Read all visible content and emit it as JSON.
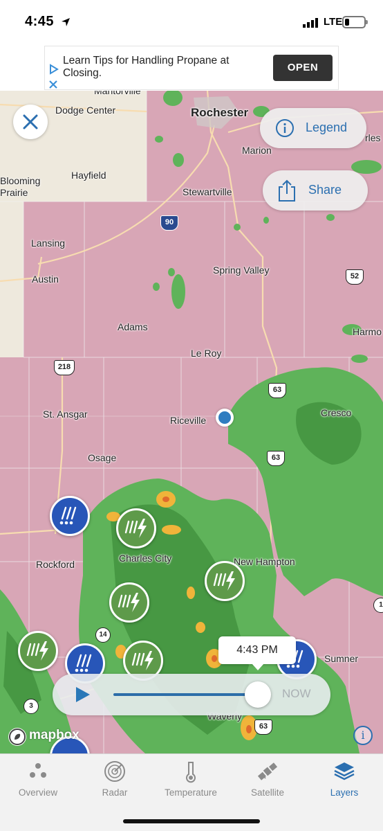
{
  "status": {
    "time": "4:45",
    "network": "LTE"
  },
  "ad": {
    "text": "Learn Tips for Handling Propane at Closing.",
    "cta": "OPEN"
  },
  "map": {
    "places": [
      {
        "id": "mantorville",
        "label": "Mantorville"
      },
      {
        "id": "rochester",
        "label": "Rochester"
      },
      {
        "id": "dodge-center",
        "label": "Dodge Center"
      },
      {
        "id": "marion",
        "label": "Marion"
      },
      {
        "id": "hayfield",
        "label": "Hayfield"
      },
      {
        "id": "blooming-prairie",
        "label": "Blooming\nPrairie"
      },
      {
        "id": "stewartville",
        "label": "Stewartville"
      },
      {
        "id": "lansing",
        "label": "Lansing"
      },
      {
        "id": "spring-valley",
        "label": "Spring Valley"
      },
      {
        "id": "austin",
        "label": "Austin"
      },
      {
        "id": "adams",
        "label": "Adams"
      },
      {
        "id": "le-roy",
        "label": "Le Roy"
      },
      {
        "id": "st-ansgar",
        "label": "St. Ansgar"
      },
      {
        "id": "riceville",
        "label": "Riceville"
      },
      {
        "id": "cresco",
        "label": "Cresco"
      },
      {
        "id": "osage",
        "label": "Osage"
      },
      {
        "id": "rockford",
        "label": "Rockford"
      },
      {
        "id": "charles-city",
        "label": "Charles City"
      },
      {
        "id": "new-hampton",
        "label": "New Hampton"
      },
      {
        "id": "sumner",
        "label": "Sumner"
      },
      {
        "id": "waverly",
        "label": "Waverly"
      },
      {
        "id": "harmony-partial",
        "label": "Harmo"
      },
      {
        "id": "charles-partial",
        "label": "rles"
      }
    ],
    "routes": [
      "90",
      "52",
      "218",
      "63",
      "63",
      "63",
      "14",
      "3",
      "1"
    ],
    "legend_label": "Legend",
    "share_label": "Share",
    "timeline": {
      "time_tip": "4:43 PM",
      "now_label": "NOW",
      "progress": 0.92
    },
    "attribution": "mapbox",
    "colors": {
      "warning_area": "#d8a6b6",
      "radar_light": "#5fb35a",
      "radar_heavy": "#3f8f3c",
      "radar_intense": "#f0b43a",
      "storm_marker": "#5e9a4a",
      "hail_marker": "#2856b8",
      "accent": "#2b6fb0"
    }
  },
  "tabs": [
    {
      "label": "Overview",
      "icon": "dots-icon"
    },
    {
      "label": "Radar",
      "icon": "radar-icon"
    },
    {
      "label": "Temperature",
      "icon": "thermometer-icon"
    },
    {
      "label": "Satellite",
      "icon": "satellite-icon"
    },
    {
      "label": "Layers",
      "icon": "layers-icon",
      "active": true
    }
  ]
}
